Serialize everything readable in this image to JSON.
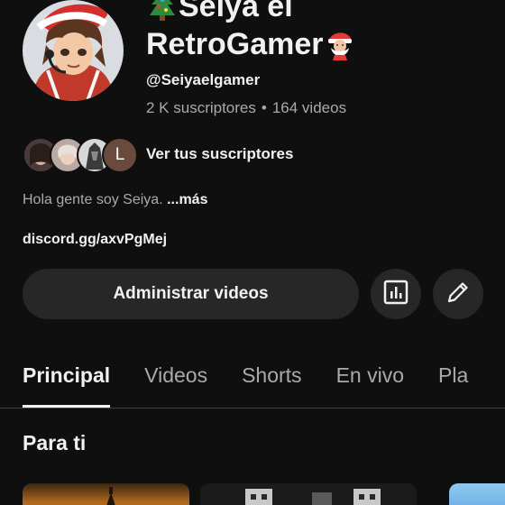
{
  "channel": {
    "name_line1": "Seiya el",
    "name_line2": "RetroGamer",
    "handle": "@Seiyaelgamer",
    "subscribers": "2 K suscriptores",
    "separator": "•",
    "videos": "164 videos",
    "subscriber_avatar_letter": "L",
    "view_subscribers": "Ver tus suscriptores",
    "description": "Hola gente soy Seiya.",
    "more": "...más",
    "link": "discord.gg/axvPgMej"
  },
  "actions": {
    "manage_videos": "Administrar videos"
  },
  "tabs": [
    {
      "label": "Principal",
      "active": true
    },
    {
      "label": "Videos",
      "active": false
    },
    {
      "label": "Shorts",
      "active": false
    },
    {
      "label": "En vivo",
      "active": false
    },
    {
      "label": "Pla",
      "active": false
    }
  ],
  "section": {
    "title": "Para ti"
  },
  "icons": {
    "tree": "christmas-tree-icon",
    "santa": "santa-icon",
    "analytics": "analytics-icon",
    "edit": "pencil-icon"
  },
  "colors": {
    "background": "#0f0f0f",
    "button": "#272727",
    "text_primary": "#f1f1f1",
    "text_secondary": "#aaaaaa"
  }
}
